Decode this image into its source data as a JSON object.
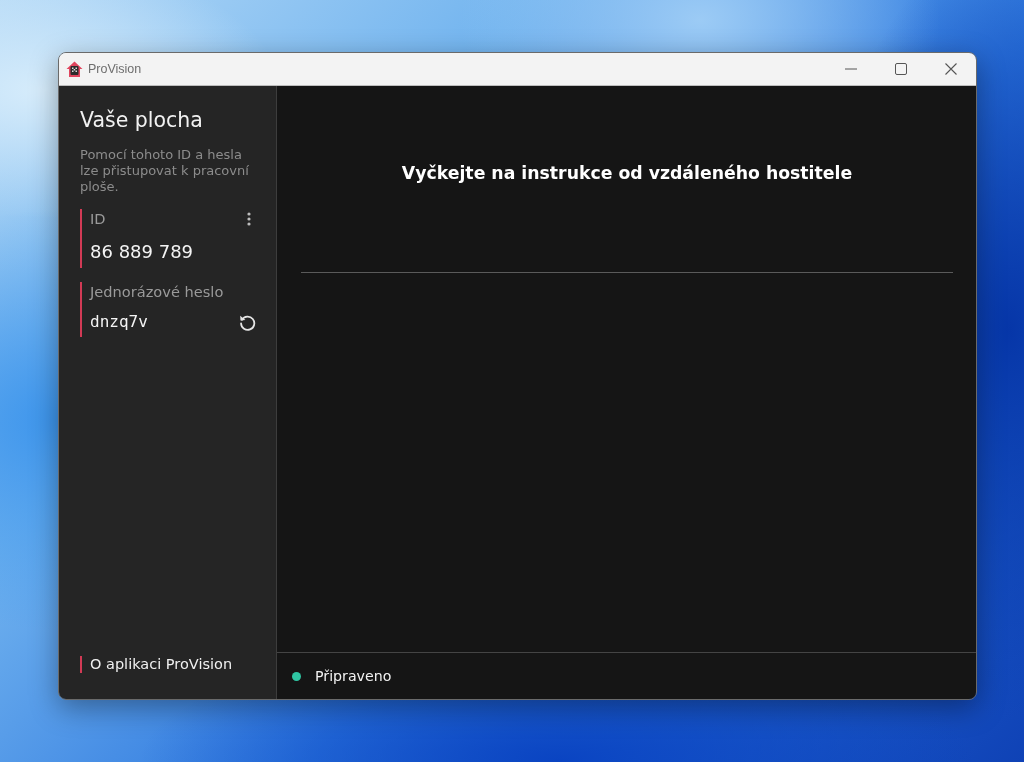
{
  "window": {
    "title": "ProVision"
  },
  "sidebar": {
    "title": "Vaše plocha",
    "description": "Pomocí tohoto ID a hesla lze přistupovat k pracovní ploše.",
    "id_field": {
      "label": "ID",
      "value": "86 889 789"
    },
    "password_field": {
      "label": "Jednorázové heslo",
      "value": "dnzq7v"
    },
    "about_link": "O aplikaci ProVision"
  },
  "main": {
    "message": "Vyčkejte na instrukce od vzdáleného hostitele"
  },
  "status_bar": {
    "status": "Připraveno"
  }
}
